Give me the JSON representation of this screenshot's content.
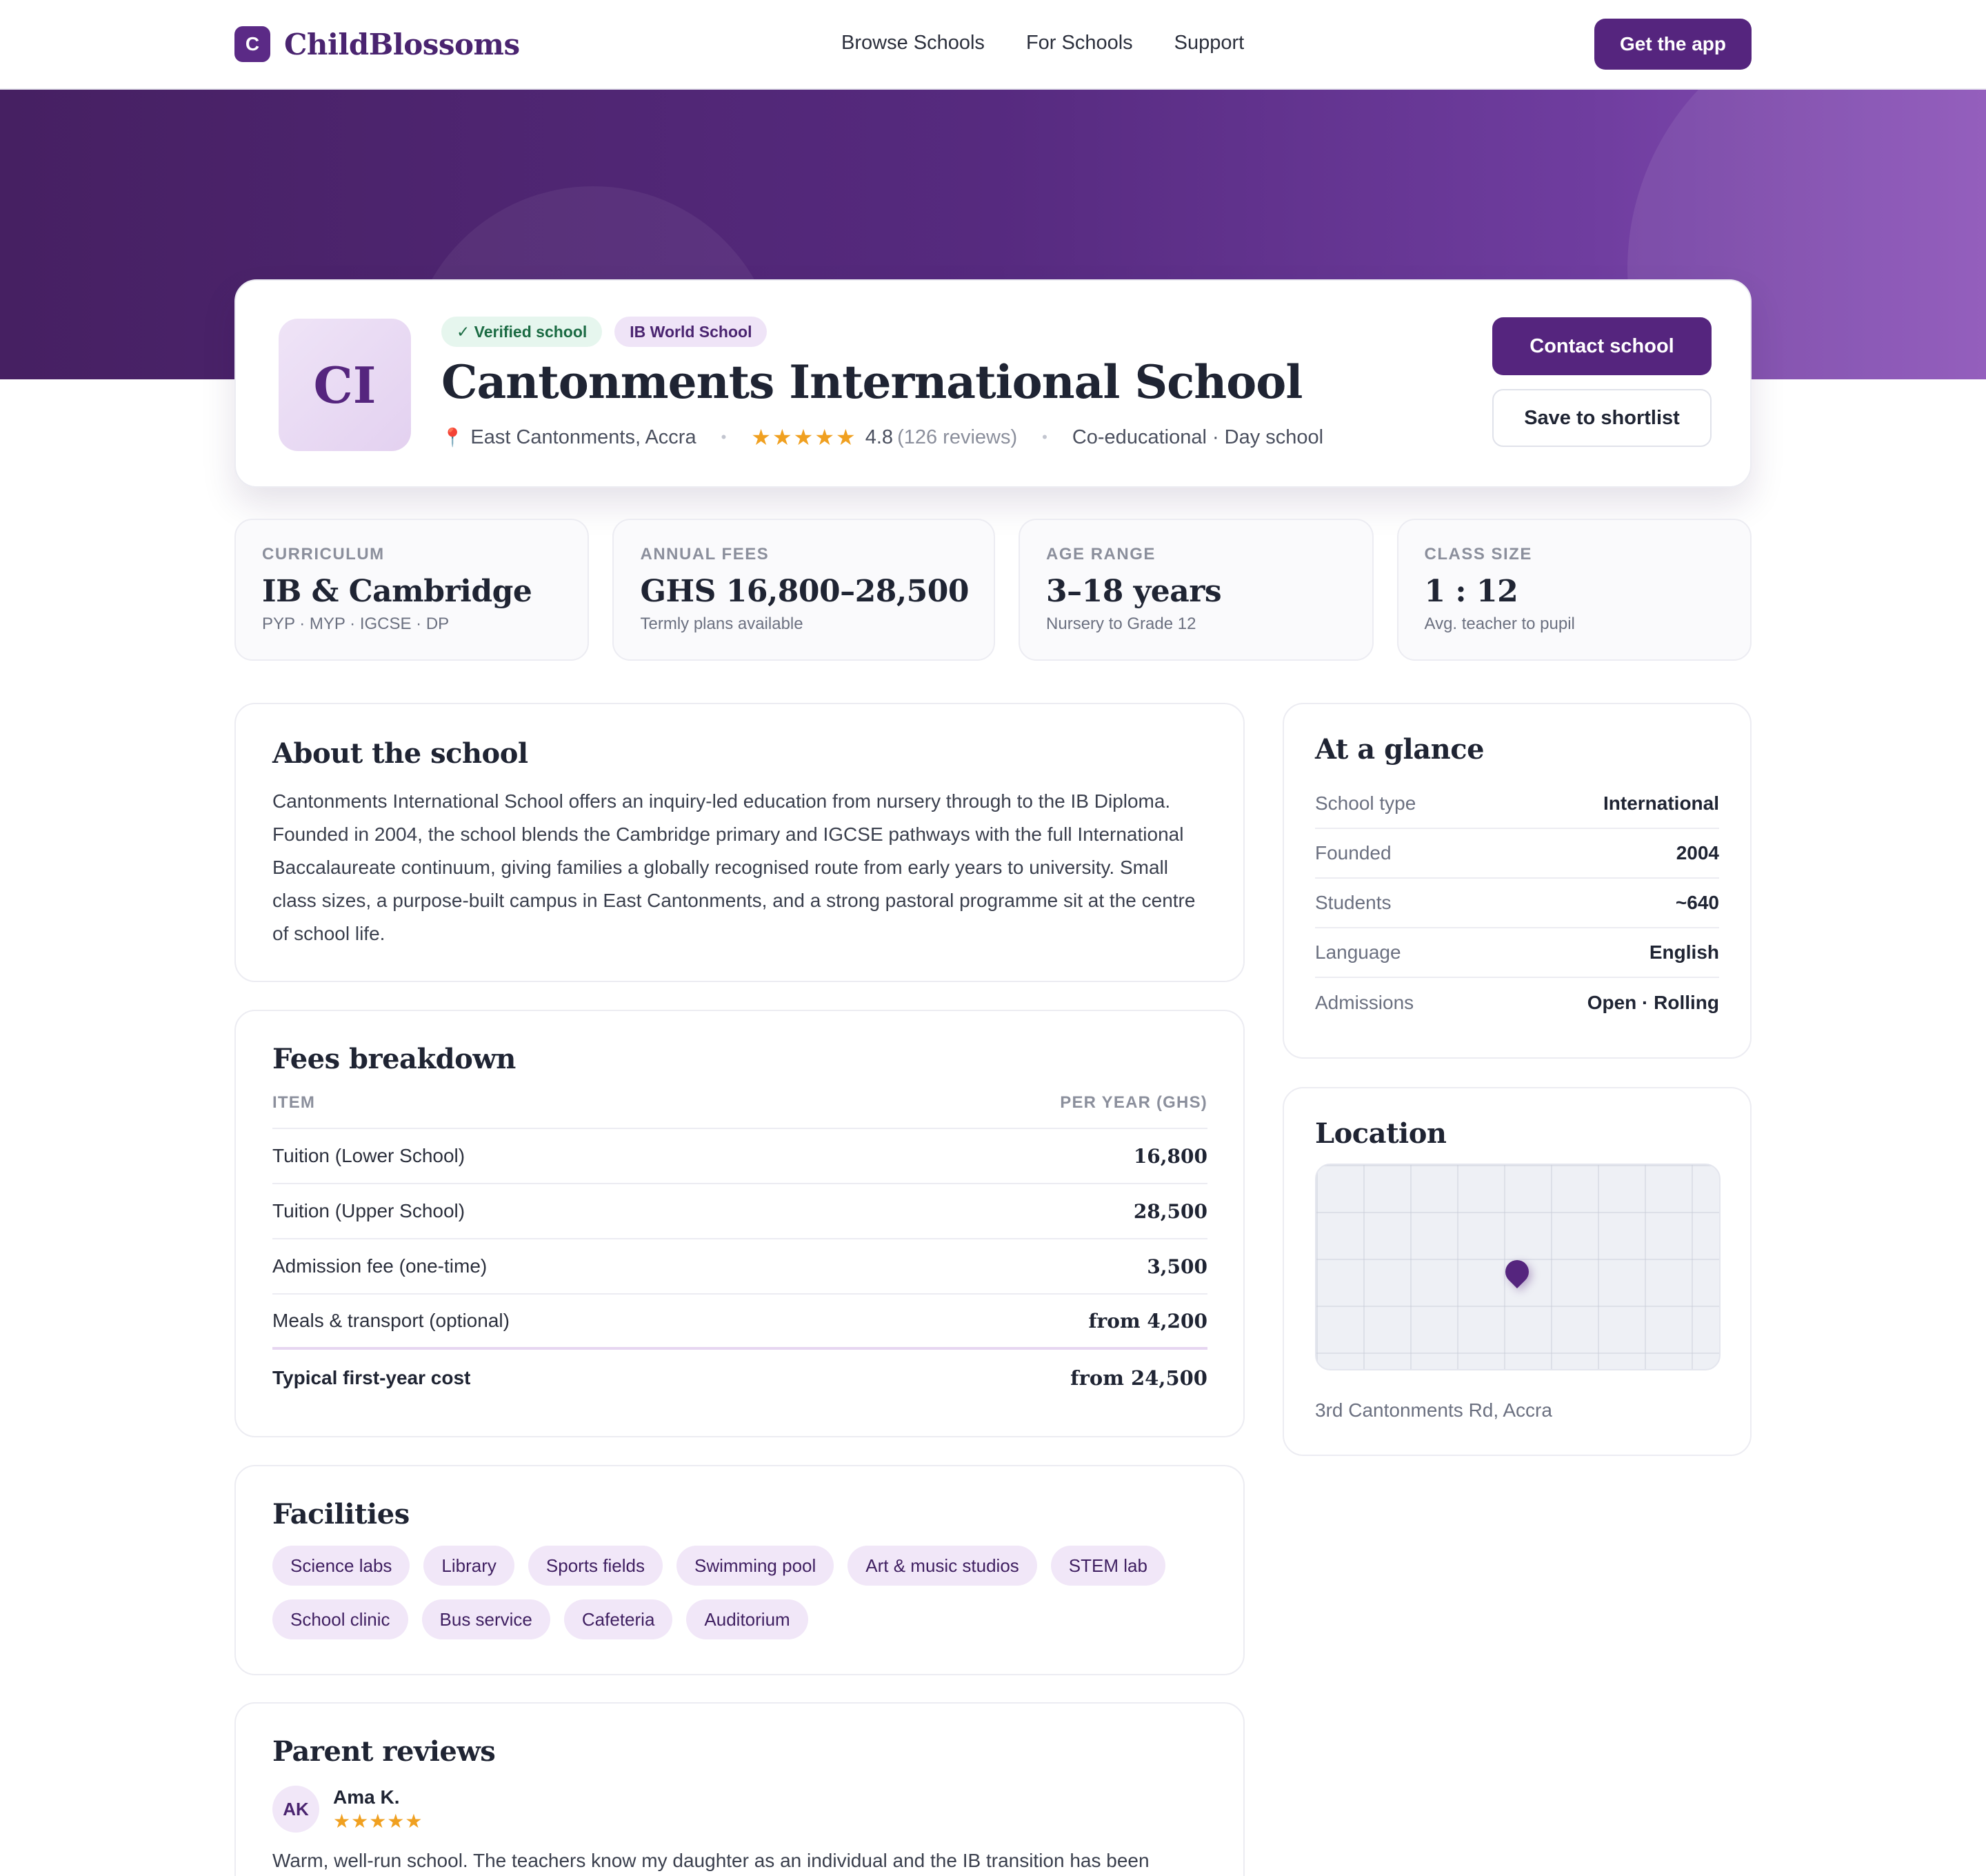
{
  "nav": {
    "brand_initial": "C",
    "brand_name": "ChildBlossoms",
    "links": [
      "Browse Schools",
      "For Schools",
      "Support"
    ],
    "cta": "Get the app"
  },
  "school": {
    "initials": "CI",
    "badges": {
      "verified": "✓ Verified school",
      "ib": "IB World School"
    },
    "name": "Cantonments International School",
    "location": "East Cantonments, Accra",
    "stars": "★★★★★",
    "rating": "4.8",
    "reviews_count": "(126 reviews)",
    "type": "Co-educational · Day school",
    "contact_label": "Contact school",
    "save_label": "Save to shortlist"
  },
  "stats": [
    {
      "label": "CURRICULUM",
      "value": "IB & Cambridge",
      "sub": "PYP · MYP · IGCSE · DP"
    },
    {
      "label": "ANNUAL FEES",
      "value": "GHS 16,800–28,500",
      "sub": "Termly plans available"
    },
    {
      "label": "AGE RANGE",
      "value": "3–18 years",
      "sub": "Nursery to Grade 12"
    },
    {
      "label": "CLASS SIZE",
      "value": "1 : 12",
      "sub": "Avg. teacher to pupil"
    }
  ],
  "about": {
    "title": "About the school",
    "text": "Cantonments International School offers an inquiry-led education from nursery through to the IB Diploma. Founded in 2004, the school blends the Cambridge primary and IGCSE pathways with the full International Baccalaureate continuum, giving families a globally recognised route from early years to university. Small class sizes, a purpose-built campus in East Cantonments, and a strong pastoral programme sit at the centre of school life."
  },
  "fees": {
    "title": "Fees breakdown",
    "col_item": "ITEM",
    "col_amount": "PER YEAR (GHS)",
    "rows": [
      {
        "item": "Tuition (Lower School)",
        "amount": "16,800"
      },
      {
        "item": "Tuition (Upper School)",
        "amount": "28,500"
      },
      {
        "item": "Admission fee (one-time)",
        "amount": "3,500"
      },
      {
        "item": "Meals & transport (optional)",
        "amount": "from 4,200"
      }
    ],
    "total_label": "Typical first-year cost",
    "total_amount": "from 24,500"
  },
  "facilities": {
    "title": "Facilities",
    "items": [
      "Science labs",
      "Library",
      "Sports fields",
      "Swimming pool",
      "Art & music studios",
      "STEM lab",
      "School clinic",
      "Bus service",
      "Cafeteria",
      "Auditorium"
    ]
  },
  "reviews": {
    "title": "Parent reviews",
    "first": {
      "initials": "AK",
      "name": "Ama K.",
      "stars": "★★★★★",
      "text": "Warm, well-run school. The teachers know my daughter as an individual and the IB transition has been"
    }
  },
  "glance": {
    "title": "At a glance",
    "rows": [
      {
        "key": "School type",
        "value": "International"
      },
      {
        "key": "Founded",
        "value": "2004"
      },
      {
        "key": "Students",
        "value": "~640"
      },
      {
        "key": "Language",
        "value": "English"
      },
      {
        "key": "Admissions",
        "value": "Open · Rolling"
      }
    ]
  },
  "location": {
    "title": "Location",
    "address": "3rd Cantonments Rd, Accra"
  },
  "colors": {
    "brand": "#55257e",
    "accent_soft": "#f1e7f8",
    "star": "#f0a020",
    "verified": "#1b6b43"
  }
}
